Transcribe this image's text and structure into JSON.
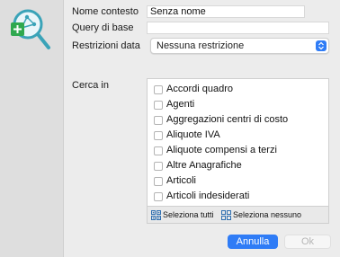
{
  "form": {
    "context_name_label": "Nome contesto",
    "context_name_value": "Senza nome",
    "base_query_label": "Query di base",
    "base_query_value": "",
    "date_restrictions_label": "Restrizioni data",
    "date_restrictions_value": "Nessuna restrizione",
    "search_in_label": "Cerca in"
  },
  "search_in_items": [
    {
      "label": "Accordi quadro",
      "checked": false
    },
    {
      "label": "Agenti",
      "checked": false
    },
    {
      "label": "Aggregazioni centri di costo",
      "checked": false
    },
    {
      "label": "Aliquote IVA",
      "checked": false
    },
    {
      "label": "Aliquote compensi a terzi",
      "checked": false
    },
    {
      "label": "Altre Anagrafiche",
      "checked": false
    },
    {
      "label": "Articoli",
      "checked": false
    },
    {
      "label": "Articoli indesiderati",
      "checked": false
    }
  ],
  "list_toolbar": {
    "select_all_label": "Seleziona tutti",
    "select_none_label": "Seleziona nessuno"
  },
  "buttons": {
    "cancel_label": "Annulla",
    "ok_label": "Ok"
  },
  "colors": {
    "accent": "#2f7cf6",
    "icon_teal": "#3aa3b8",
    "icon_green": "#2fa84f"
  }
}
